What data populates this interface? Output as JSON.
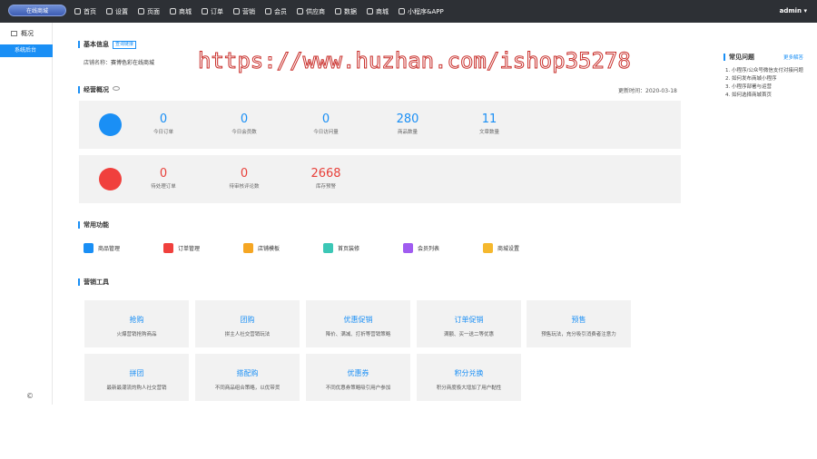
{
  "topbar": {
    "logo_text": "在线商城",
    "nav": [
      "首页",
      "设置",
      "页面",
      "商城",
      "订单",
      "营销",
      "会员",
      "供应商",
      "数据",
      "商城",
      "小程序&APP"
    ],
    "admin": "admin ▾"
  },
  "sidebar": {
    "overview": "概况",
    "active": "系统后台",
    "footer": "©"
  },
  "basic": {
    "title": "基本信息",
    "tag": "查询链接",
    "store_label": "店铺名称：",
    "store_name": "赛博色彩在线商城"
  },
  "watermark": "https://www.huzhan.com/ishop35278",
  "ops": {
    "title": "经营概况",
    "update_time": "更新时间：2020-03-18",
    "row1": [
      {
        "num": "0",
        "label": "今日订单"
      },
      {
        "num": "0",
        "label": "今日会员数"
      },
      {
        "num": "0",
        "label": "今日访问量"
      },
      {
        "num": "280",
        "label": "商品数量"
      },
      {
        "num": "11",
        "label": "文章数量"
      }
    ],
    "row2": [
      {
        "num": "0",
        "label": "待处理订单"
      },
      {
        "num": "0",
        "label": "待审核评论数"
      },
      {
        "num": "2668",
        "label": "库存预警"
      }
    ]
  },
  "common": {
    "title": "常用功能",
    "items": [
      {
        "label": "商品管理",
        "color": "#1a8ff5"
      },
      {
        "label": "订单管理",
        "color": "#f0403d"
      },
      {
        "label": "店铺模板",
        "color": "#f5a623"
      },
      {
        "label": "首页装修",
        "color": "#3cc7b6"
      },
      {
        "label": "会员列表",
        "color": "#a05cf0"
      },
      {
        "label": "商城设置",
        "color": "#f5b82e"
      }
    ]
  },
  "marketing": {
    "title": "营销工具",
    "tools": [
      {
        "name": "抢购",
        "desc": "火爆营销抢购商品"
      },
      {
        "name": "团购",
        "desc": "拼主人社交营销玩法"
      },
      {
        "name": "优惠促销",
        "desc": "降价、满减、打折等营销策略"
      },
      {
        "name": "订单促销",
        "desc": "满额、买一送二等优惠"
      },
      {
        "name": "预售",
        "desc": "预售玩法，充分吸引消费者注意力"
      },
      {
        "name": "拼团",
        "desc": "最新最潮流的购人社交营销"
      },
      {
        "name": "搭配购",
        "desc": "不同商品组合策略，以优带货"
      },
      {
        "name": "优惠券",
        "desc": "不同优惠券策略吸引用户参加"
      },
      {
        "name": "积分兑换",
        "desc": "积分商度极大增加了用户黏性"
      }
    ]
  },
  "faq": {
    "title": "常见问题",
    "more": "更多解答",
    "items": [
      "1. 小程序/公众号微信支付对接问题",
      "2. 如何发布商城小程序",
      "3. 小程序部署与运营",
      "4. 如何选择商城首页"
    ]
  }
}
